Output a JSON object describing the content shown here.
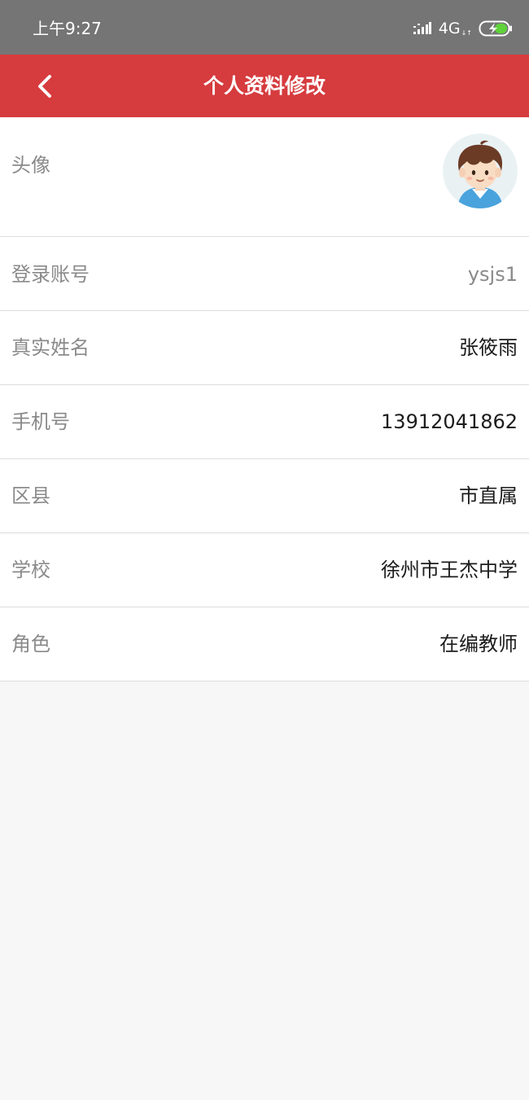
{
  "status_bar": {
    "time": "上午9:27",
    "network": "4G",
    "network_sub": "..ıl"
  },
  "nav": {
    "title": "个人资料修改",
    "back_icon": "chevron-left-icon",
    "background": "#d63b3e"
  },
  "profile": {
    "avatar_label": "头像",
    "rows": [
      {
        "label": "登录账号",
        "value": "ysjs1"
      },
      {
        "label": "真实姓名",
        "value": "张筱雨"
      },
      {
        "label": "手机号",
        "value": "13912041862"
      },
      {
        "label": "区县",
        "value": "市直属"
      },
      {
        "label": "学校",
        "value": "徐州市王杰中学"
      },
      {
        "label": "角色",
        "value": "在编教师"
      }
    ]
  }
}
